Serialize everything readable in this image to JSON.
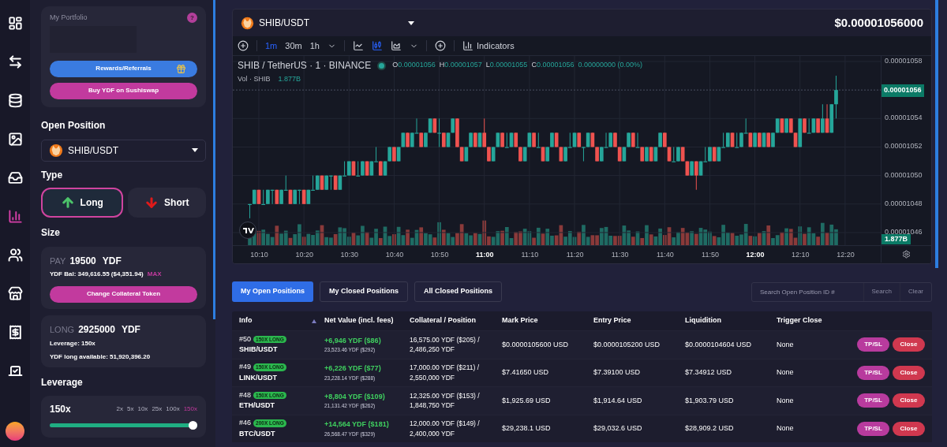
{
  "nav_rail": {
    "items": [
      {
        "kind": "dashboard",
        "selected": false
      },
      {
        "kind": "swap",
        "selected": false
      },
      {
        "kind": "stack",
        "selected": false
      },
      {
        "kind": "image",
        "selected": false
      },
      {
        "kind": "chest",
        "selected": false
      },
      {
        "kind": "trade",
        "selected": true
      },
      {
        "kind": "people",
        "selected": false
      },
      {
        "kind": "store",
        "selected": false
      },
      {
        "kind": "receipt",
        "selected": false
      },
      {
        "kind": "vote",
        "selected": false
      }
    ]
  },
  "portfolio": {
    "title": "My Portfolio",
    "help": "?",
    "buttons": [
      {
        "label": "Rewards/Referrals",
        "kind": "rewards"
      },
      {
        "label": "Buy YDF on Sushiswap",
        "kind": "buy"
      }
    ]
  },
  "open_position": {
    "heading": "Open Position",
    "pair": "SHIB/USDT"
  },
  "type": {
    "heading": "Type",
    "options": [
      {
        "label": "Long",
        "kind": "long",
        "selected": true
      },
      {
        "label": "Short",
        "kind": "short",
        "selected": false
      }
    ]
  },
  "size": {
    "heading": "Size",
    "pay": {
      "label": "PAY",
      "amount": "19500",
      "unit": "YDF",
      "balance": "YDF Bal: 349,616.55 ($4,351.94)",
      "max": "MAX",
      "button": "Change Collateral Token"
    },
    "long": {
      "label": "LONG",
      "amount": "2925000",
      "unit": "YDF",
      "leverage": "Leverage: 150x",
      "available": "YDF long available: 51,920,396.20"
    }
  },
  "leverage": {
    "heading": "Leverage",
    "value": "150x",
    "level": 1,
    "presets": [
      {
        "label": "2x",
        "selected": false
      },
      {
        "label": "5x",
        "selected": false
      },
      {
        "label": "10x",
        "selected": false
      },
      {
        "label": "25x",
        "selected": false
      },
      {
        "label": "100x",
        "selected": false
      },
      {
        "label": "150x",
        "selected": true
      }
    ]
  },
  "chart": {
    "pair": "SHIB/USDT",
    "price": "$0.00001056000",
    "intervals": [
      {
        "label": "1m",
        "selected": true
      },
      {
        "label": "30m",
        "selected": false
      },
      {
        "label": "1h",
        "selected": false
      }
    ],
    "indicators": "Indicators",
    "legend": {
      "symbol": "SHIB / TetherUS · 1 · BINANCE",
      "values": [
        {
          "key": "O",
          "value": "0.00001056"
        },
        {
          "key": "H",
          "value": "0.00001057"
        },
        {
          "key": "L",
          "value": "0.00001055"
        },
        {
          "key": "C",
          "value": "0.00001056"
        }
      ],
      "change": "0.00000000 (0.00%)",
      "volume_label": "Vol · SHIB",
      "volume": "1.877B"
    },
    "last_price": "0.00001056",
    "last_volume": "1.877B",
    "xtick_major": [
      false,
      false,
      false,
      false,
      false,
      true,
      false,
      false,
      false,
      false,
      false,
      true,
      false,
      false
    ],
    "chart_data": {
      "type": "candlestick",
      "x": [
        608,
        609,
        610,
        611,
        612,
        613,
        614,
        615,
        616,
        617,
        618,
        619,
        620,
        621,
        622,
        623,
        624,
        625,
        626,
        627,
        628,
        629,
        630,
        631,
        632,
        633,
        634,
        635,
        636,
        637,
        638,
        639,
        640,
        641,
        642,
        643,
        644,
        645,
        646,
        647,
        648,
        649,
        650,
        651,
        652,
        653,
        654,
        655,
        656,
        657,
        658,
        659,
        660,
        661,
        662,
        663,
        664,
        665,
        666,
        667,
        668,
        669,
        670,
        671,
        672,
        673,
        674,
        675,
        676,
        677,
        678,
        679,
        680,
        681,
        682,
        683,
        684,
        685,
        686,
        687,
        688,
        689,
        690,
        691,
        692,
        693,
        694,
        695,
        696,
        697,
        698,
        699,
        700,
        701,
        702,
        703,
        704,
        705,
        706,
        707,
        708,
        709,
        710,
        711,
        712,
        713,
        714,
        715,
        716,
        717,
        718,
        719,
        720,
        721,
        722,
        723,
        724,
        725,
        726,
        727,
        728,
        729,
        730,
        731,
        732,
        733,
        734,
        735,
        736,
        737,
        738
      ],
      "xlim": [
        604.23,
        759.09
      ],
      "ylim": [
        1.045113e-05,
        1.058387e-05
      ],
      "grid": true,
      "ref_lines": [
        {
          "axis": "y",
          "value": 1.056e-05
        }
      ],
      "ohlc": [
        [
          1.048e-05,
          1.048e-05,
          1.047e-05,
          1.048e-05
        ],
        [
          1.048e-05,
          1.049e-05,
          1.048e-05,
          1.049e-05
        ],
        [
          1.049e-05,
          1.049e-05,
          1.048e-05,
          1.048e-05
        ],
        [
          1.048e-05,
          1.049e-05,
          1.048e-05,
          1.048e-05
        ],
        [
          1.048e-05,
          1.049e-05,
          1.048e-05,
          1.049e-05
        ],
        [
          1.049e-05,
          1.049e-05,
          1.048e-05,
          1.049e-05
        ],
        [
          1.049e-05,
          1.049e-05,
          1.048e-05,
          1.048e-05
        ],
        [
          1.048e-05,
          1.049e-05,
          1.048e-05,
          1.049e-05
        ],
        [
          1.049e-05,
          1.05e-05,
          1.049e-05,
          1.049e-05
        ],
        [
          1.049e-05,
          1.049e-05,
          1.048e-05,
          1.048e-05
        ],
        [
          1.048e-05,
          1.049e-05,
          1.048e-05,
          1.049e-05
        ],
        [
          1.049e-05,
          1.049e-05,
          1.048e-05,
          1.049e-05
        ],
        [
          1.049e-05,
          1.049e-05,
          1.048e-05,
          1.048e-05
        ],
        [
          1.048e-05,
          1.049e-05,
          1.048e-05,
          1.049e-05
        ],
        [
          1.049e-05,
          1.05e-05,
          1.049e-05,
          1.049e-05
        ],
        [
          1.049e-05,
          1.05e-05,
          1.049e-05,
          1.05e-05
        ],
        [
          1.05e-05,
          1.05e-05,
          1.049e-05,
          1.049e-05
        ],
        [
          1.049e-05,
          1.05e-05,
          1.049e-05,
          1.05e-05
        ],
        [
          1.05e-05,
          1.05e-05,
          1.049e-05,
          1.05e-05
        ],
        [
          1.05e-05,
          1.05e-05,
          1.049e-05,
          1.049e-05
        ],
        [
          1.049e-05,
          1.05e-05,
          1.049e-05,
          1.05e-05
        ],
        [
          1.05e-05,
          1.051e-05,
          1.05e-05,
          1.05e-05
        ],
        [
          1.05e-05,
          1.051e-05,
          1.05e-05,
          1.051e-05
        ],
        [
          1.051e-05,
          1.051e-05,
          1.05e-05,
          1.05e-05
        ],
        [
          1.05e-05,
          1.051e-05,
          1.05e-05,
          1.05e-05
        ],
        [
          1.05e-05,
          1.051e-05,
          1.05e-05,
          1.051e-05
        ],
        [
          1.051e-05,
          1.051e-05,
          1.05e-05,
          1.05e-05
        ],
        [
          1.05e-05,
          1.051e-05,
          1.05e-05,
          1.051e-05
        ],
        [
          1.051e-05,
          1.052e-05,
          1.051e-05,
          1.051e-05
        ],
        [
          1.051e-05,
          1.051e-05,
          1.05e-05,
          1.05e-05
        ],
        [
          1.05e-05,
          1.051e-05,
          1.05e-05,
          1.051e-05
        ],
        [
          1.051e-05,
          1.052e-05,
          1.051e-05,
          1.052e-05
        ],
        [
          1.052e-05,
          1.052e-05,
          1.051e-05,
          1.051e-05
        ],
        [
          1.051e-05,
          1.052e-05,
          1.051e-05,
          1.052e-05
        ],
        [
          1.052e-05,
          1.053e-05,
          1.052e-05,
          1.053e-05
        ],
        [
          1.053e-05,
          1.053e-05,
          1.052e-05,
          1.052e-05
        ],
        [
          1.052e-05,
          1.053e-05,
          1.052e-05,
          1.053e-05
        ],
        [
          1.053e-05,
          1.054e-05,
          1.053e-05,
          1.053e-05
        ],
        [
          1.053e-05,
          1.053e-05,
          1.052e-05,
          1.052e-05
        ],
        [
          1.052e-05,
          1.053e-05,
          1.052e-05,
          1.053e-05
        ],
        [
          1.053e-05,
          1.054e-05,
          1.053e-05,
          1.054e-05
        ],
        [
          1.054e-05,
          1.054e-05,
          1.053e-05,
          1.053e-05
        ],
        [
          1.053e-05,
          1.054e-05,
          1.052e-05,
          1.053e-05
        ],
        [
          1.053e-05,
          1.053e-05,
          1.052e-05,
          1.052e-05
        ],
        [
          1.052e-05,
          1.053e-05,
          1.052e-05,
          1.053e-05
        ],
        [
          1.053e-05,
          1.054e-05,
          1.053e-05,
          1.054e-05
        ],
        [
          1.054e-05,
          1.054e-05,
          1.052e-05,
          1.052e-05
        ],
        [
          1.052e-05,
          1.052e-05,
          1.051e-05,
          1.051e-05
        ],
        [
          1.051e-05,
          1.052e-05,
          1.051e-05,
          1.052e-05
        ],
        [
          1.052e-05,
          1.053e-05,
          1.052e-05,
          1.053e-05
        ],
        [
          1.053e-05,
          1.053e-05,
          1.052e-05,
          1.052e-05
        ],
        [
          1.052e-05,
          1.053e-05,
          1.052e-05,
          1.053e-05
        ],
        [
          1.053e-05,
          1.054e-05,
          1.052e-05,
          1.052e-05
        ],
        [
          1.052e-05,
          1.052e-05,
          1.051e-05,
          1.051e-05
        ],
        [
          1.051e-05,
          1.052e-05,
          1.051e-05,
          1.052e-05
        ],
        [
          1.052e-05,
          1.053e-05,
          1.052e-05,
          1.053e-05
        ],
        [
          1.053e-05,
          1.053e-05,
          1.052e-05,
          1.052e-05
        ],
        [
          1.052e-05,
          1.053e-05,
          1.052e-05,
          1.052e-05
        ],
        [
          1.052e-05,
          1.053e-05,
          1.052e-05,
          1.053e-05
        ],
        [
          1.053e-05,
          1.053e-05,
          1.052e-05,
          1.052e-05
        ],
        [
          1.052e-05,
          1.052e-05,
          1.051e-05,
          1.051e-05
        ],
        [
          1.051e-05,
          1.052e-05,
          1.051e-05,
          1.052e-05
        ],
        [
          1.052e-05,
          1.053e-05,
          1.052e-05,
          1.053e-05
        ],
        [
          1.053e-05,
          1.053e-05,
          1.052e-05,
          1.052e-05
        ],
        [
          1.052e-05,
          1.053e-05,
          1.052e-05,
          1.052e-05
        ],
        [
          1.052e-05,
          1.052e-05,
          1.051e-05,
          1.051e-05
        ],
        [
          1.051e-05,
          1.052e-05,
          1.051e-05,
          1.052e-05
        ],
        [
          1.052e-05,
          1.053e-05,
          1.052e-05,
          1.053e-05
        ],
        [
          1.053e-05,
          1.053e-05,
          1.052e-05,
          1.052e-05
        ],
        [
          1.052e-05,
          1.052e-05,
          1.051e-05,
          1.051e-05
        ],
        [
          1.051e-05,
          1.052e-05,
          1.051e-05,
          1.052e-05
        ],
        [
          1.052e-05,
          1.053e-05,
          1.052e-05,
          1.052e-05
        ],
        [
          1.052e-05,
          1.053e-05,
          1.052e-05,
          1.053e-05
        ],
        [
          1.053e-05,
          1.053e-05,
          1.052e-05,
          1.052e-05
        ],
        [
          1.052e-05,
          1.052e-05,
          1.051e-05,
          1.052e-05
        ],
        [
          1.052e-05,
          1.053e-05,
          1.052e-05,
          1.053e-05
        ],
        [
          1.053e-05,
          1.053e-05,
          1.052e-05,
          1.052e-05
        ],
        [
          1.052e-05,
          1.052e-05,
          1.051e-05,
          1.051e-05
        ],
        [
          1.051e-05,
          1.052e-05,
          1.051e-05,
          1.052e-05
        ],
        [
          1.052e-05,
          1.053e-05,
          1.052e-05,
          1.052e-05
        ],
        [
          1.052e-05,
          1.053e-05,
          1.052e-05,
          1.053e-05
        ],
        [
          1.053e-05,
          1.053e-05,
          1.052e-05,
          1.052e-05
        ],
        [
          1.052e-05,
          1.052e-05,
          1.051e-05,
          1.051e-05
        ],
        [
          1.051e-05,
          1.052e-05,
          1.051e-05,
          1.052e-05
        ],
        [
          1.052e-05,
          1.053e-05,
          1.052e-05,
          1.053e-05
        ],
        [
          1.053e-05,
          1.053e-05,
          1.052e-05,
          1.052e-05
        ],
        [
          1.052e-05,
          1.053e-05,
          1.052e-05,
          1.052e-05
        ],
        [
          1.052e-05,
          1.052e-05,
          1.051e-05,
          1.051e-05
        ],
        [
          1.051e-05,
          1.052e-05,
          1.051e-05,
          1.052e-05
        ],
        [
          1.052e-05,
          1.052e-05,
          1.051e-05,
          1.051e-05
        ],
        [
          1.051e-05,
          1.052e-05,
          1.051e-05,
          1.052e-05
        ],
        [
          1.052e-05,
          1.053e-05,
          1.052e-05,
          1.053e-05
        ],
        [
          1.053e-05,
          1.053e-05,
          1.052e-05,
          1.052e-05
        ],
        [
          1.052e-05,
          1.052e-05,
          1.051e-05,
          1.051e-05
        ],
        [
          1.051e-05,
          1.052e-05,
          1.051e-05,
          1.051e-05
        ],
        [
          1.051e-05,
          1.052e-05,
          1.051e-05,
          1.052e-05
        ],
        [
          1.052e-05,
          1.052e-05,
          1.051e-05,
          1.051e-05
        ],
        [
          1.051e-05,
          1.051e-05,
          1.05e-05,
          1.05e-05
        ],
        [
          1.05e-05,
          1.051e-05,
          1.05e-05,
          1.051e-05
        ],
        [
          1.051e-05,
          1.051e-05,
          1.049e-05,
          1.05e-05
        ],
        [
          1.05e-05,
          1.051e-05,
          1.05e-05,
          1.051e-05
        ],
        [
          1.051e-05,
          1.052e-05,
          1.051e-05,
          1.051e-05
        ],
        [
          1.051e-05,
          1.052e-05,
          1.051e-05,
          1.052e-05
        ],
        [
          1.052e-05,
          1.052e-05,
          1.051e-05,
          1.051e-05
        ],
        [
          1.051e-05,
          1.052e-05,
          1.051e-05,
          1.052e-05
        ],
        [
          1.052e-05,
          1.053e-05,
          1.052e-05,
          1.052e-05
        ],
        [
          1.052e-05,
          1.053e-05,
          1.052e-05,
          1.053e-05
        ],
        [
          1.053e-05,
          1.053e-05,
          1.052e-05,
          1.052e-05
        ],
        [
          1.052e-05,
          1.053e-05,
          1.052e-05,
          1.052e-05
        ],
        [
          1.052e-05,
          1.053e-05,
          1.052e-05,
          1.053e-05
        ],
        [
          1.053e-05,
          1.054e-05,
          1.053e-05,
          1.053e-05
        ],
        [
          1.053e-05,
          1.053e-05,
          1.052e-05,
          1.052e-05
        ],
        [
          1.052e-05,
          1.053e-05,
          1.052e-05,
          1.053e-05
        ],
        [
          1.053e-05,
          1.053e-05,
          1.052e-05,
          1.052e-05
        ],
        [
          1.052e-05,
          1.053e-05,
          1.052e-05,
          1.053e-05
        ],
        [
          1.053e-05,
          1.053e-05,
          1.052e-05,
          1.052e-05
        ],
        [
          1.052e-05,
          1.053e-05,
          1.052e-05,
          1.053e-05
        ],
        [
          1.053e-05,
          1.054e-05,
          1.053e-05,
          1.054e-05
        ],
        [
          1.054e-05,
          1.054e-05,
          1.053e-05,
          1.053e-05
        ],
        [
          1.053e-05,
          1.054e-05,
          1.053e-05,
          1.054e-05
        ],
        [
          1.054e-05,
          1.054e-05,
          1.053e-05,
          1.053e-05
        ],
        [
          1.053e-05,
          1.053e-05,
          1.052e-05,
          1.052e-05
        ],
        [
          1.052e-05,
          1.054e-05,
          1.052e-05,
          1.054e-05
        ],
        [
          1.054e-05,
          1.054e-05,
          1.053e-05,
          1.053e-05
        ],
        [
          1.053e-05,
          1.054e-05,
          1.053e-05,
          1.053e-05
        ],
        [
          1.053e-05,
          1.054e-05,
          1.053e-05,
          1.054e-05
        ],
        [
          1.054e-05,
          1.054e-05,
          1.053e-05,
          1.053e-05
        ],
        [
          1.053e-05,
          1.055e-05,
          1.053e-05,
          1.054e-05
        ],
        [
          1.054e-05,
          1.055e-05,
          1.053e-05,
          1.053e-05
        ],
        [
          1.053e-05,
          1.055e-05,
          1.053e-05,
          1.055e-05
        ],
        [
          1.055e-05,
          1.057e-05,
          1.054e-05,
          1.056e-05
        ]
      ],
      "xticks": [
        {
          "value": 610,
          "label": "10:10"
        },
        {
          "value": 620,
          "label": "10:20"
        },
        {
          "value": 630,
          "label": "10:30"
        },
        {
          "value": 640,
          "label": "10:40"
        },
        {
          "value": 650,
          "label": "10:50"
        },
        {
          "value": 660,
          "label": "11:00"
        },
        {
          "value": 670,
          "label": "11:10"
        },
        {
          "value": 680,
          "label": "11:20"
        },
        {
          "value": 690,
          "label": "11:30"
        },
        {
          "value": 700,
          "label": "11:40"
        },
        {
          "value": 710,
          "label": "11:50"
        },
        {
          "value": 720,
          "label": "12:00"
        },
        {
          "value": 730,
          "label": "12:10"
        },
        {
          "value": 740,
          "label": "12:20"
        }
      ],
      "yticks": [
        {
          "value": 1.058e-05,
          "label": "0.00001058"
        },
        {
          "value": 1.054e-05,
          "label": "0.00001054"
        },
        {
          "value": 1.052e-05,
          "label": "0.00001052"
        },
        {
          "value": 1.05e-05,
          "label": "0.00001050"
        },
        {
          "value": 1.048e-05,
          "label": "0.00001048"
        },
        {
          "value": 1.046e-05,
          "label": "0.00001046"
        }
      ]
    }
  },
  "positions": {
    "tabs": [
      {
        "label": "My Open Positions",
        "selected": true
      },
      {
        "label": "My Closed Positions",
        "selected": false
      },
      {
        "label": "All Closed Positions",
        "selected": false
      }
    ],
    "search": {
      "placeholder": "Search Open Position ID #",
      "search": "Search",
      "clear": "Clear"
    },
    "columns": [
      "Info",
      "Net Value (incl. fees)",
      "Collateral / Position",
      "Mark Price",
      "Entry Price",
      "Liquidition",
      "Trigger Close"
    ],
    "rows": [
      {
        "id": "#50",
        "badge": "150X LONG",
        "pair": "SHIB/USDT",
        "net": "+6,946 YDF ($86)",
        "net_sub": "23,523.46 YDF ($292)",
        "collateral": "16,575.00 YDF ($205) /",
        "position": "2,486,250 YDF",
        "mark": "$0.0000105600 USD",
        "entry": "$0.0000105200 USD",
        "liquidation": "$0.0000104604 USD",
        "trigger": "None",
        "tpsl": "TP/SL",
        "close": "Close"
      },
      {
        "id": "#49",
        "badge": "150X LONG",
        "pair": "LINK/USDT",
        "net": "+6,226 YDF ($77)",
        "net_sub": "23,228.14 YDF ($288)",
        "collateral": "17,000.00 YDF ($211) /",
        "position": "2,550,000 YDF",
        "mark": "$7.41650 USD",
        "entry": "$7.39100 USD",
        "liquidation": "$7.34912 USD",
        "trigger": "None",
        "tpsl": "TP/SL",
        "close": "Close"
      },
      {
        "id": "#48",
        "badge": "150X LONG",
        "pair": "ETH/USDT",
        "net": "+8,804 YDF ($109)",
        "net_sub": "21,131.42 YDF ($262)",
        "collateral": "12,325.00 YDF ($153) /",
        "position": "1,848,750 YDF",
        "mark": "$1,925.69 USD",
        "entry": "$1,914.64 USD",
        "liquidation": "$1,903.79 USD",
        "trigger": "None",
        "tpsl": "TP/SL",
        "close": "Close"
      },
      {
        "id": "#46",
        "badge": "200X LONG",
        "pair": "BTC/USDT",
        "net": "+14,564 YDF ($181)",
        "net_sub": "26,568.47 YDF ($329)",
        "collateral": "12,000.00 YDF ($149) /",
        "position": "2,400,000 YDF",
        "mark": "$29,238.1 USD",
        "entry": "$29,032.6 USD",
        "liquidation": "$28,909.2 USD",
        "trigger": "None",
        "tpsl": "TP/SL",
        "close": "Close"
      }
    ]
  }
}
